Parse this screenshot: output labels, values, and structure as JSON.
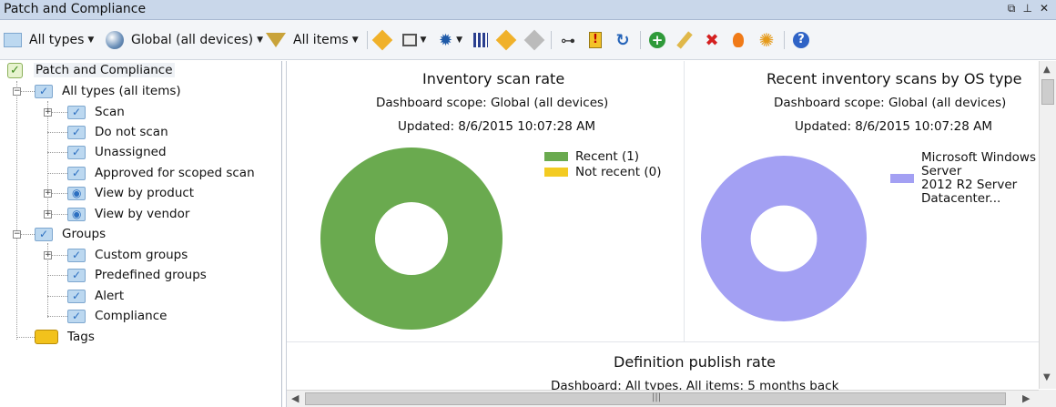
{
  "window": {
    "title": "Patch and Compliance"
  },
  "toolbar": {
    "types_label": "All types",
    "scope_label": "Global (all devices)",
    "filter_label": "All items"
  },
  "tree": {
    "root": "Patch and Compliance",
    "all_types": "All types (all items)",
    "items": [
      "Scan",
      "Do not scan",
      "Unassigned",
      "Approved for scoped scan",
      "View by product",
      "View by vendor"
    ],
    "groups": "Groups",
    "group_items": [
      "Custom groups",
      "Predefined groups",
      "Alert",
      "Compliance"
    ],
    "tags": "Tags"
  },
  "panels": {
    "inventory": {
      "title": "Inventory scan rate",
      "scope": "Dashboard scope: Global (all devices)",
      "updated": "Updated: 8/6/2015 10:07:28 AM"
    },
    "recent_os": {
      "title": "Recent inventory scans by OS type",
      "scope": "Dashboard scope: Global (all devices)",
      "updated": "Updated: 8/6/2015 10:07:28 AM"
    },
    "definition": {
      "title": "Definition publish rate",
      "scope": "Dashboard: All types, All items: 5 months back"
    }
  },
  "chart_data": [
    {
      "type": "pie",
      "title": "Inventory scan rate",
      "categories": [
        "Recent (1)",
        "Not recent (0)"
      ],
      "values": [
        1,
        0
      ],
      "colors": [
        "#6aaa4f",
        "#f3cb22"
      ],
      "legend": "right"
    },
    {
      "type": "pie",
      "title": "Recent inventory scans by OS type",
      "categories": [
        "Microsoft Windows Server 2012 R2 Server Datacenter..."
      ],
      "legend_lines": [
        "Microsoft Windows",
        "Server",
        "2012 R2 Server",
        "Datacenter..."
      ],
      "values": [
        1
      ],
      "colors": [
        "#a3a0f3"
      ],
      "legend": "right"
    }
  ],
  "colors": {
    "titlebar": "#c9d7ea",
    "accent": "#2c6fc0"
  }
}
